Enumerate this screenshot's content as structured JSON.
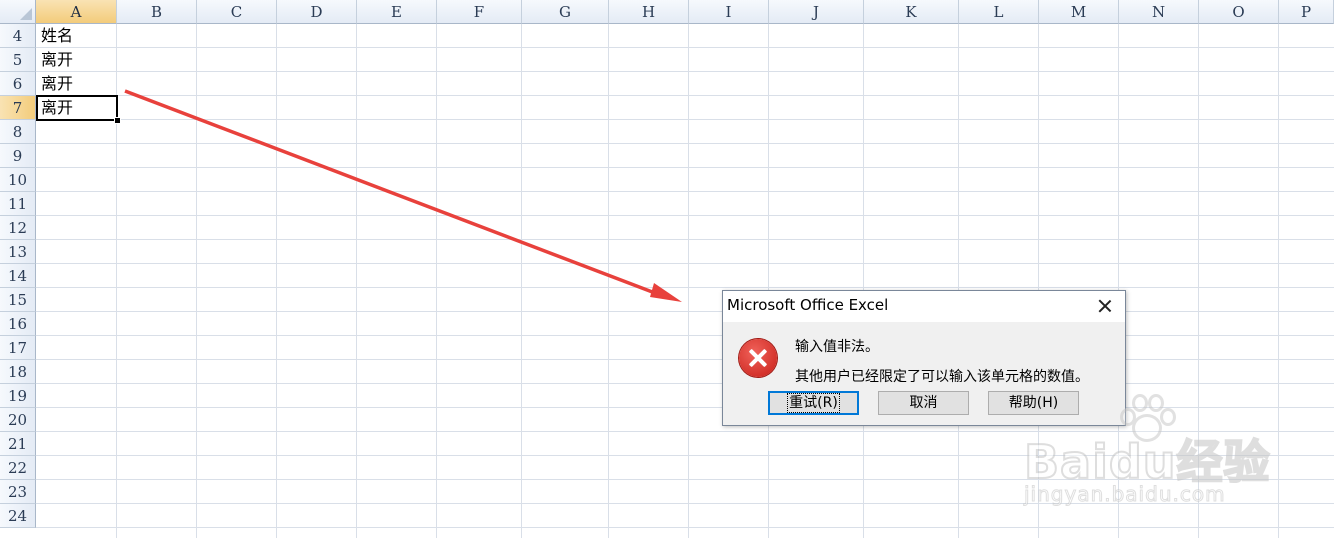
{
  "spreadsheet": {
    "columns": [
      "A",
      "B",
      "C",
      "D",
      "E",
      "F",
      "G",
      "H",
      "I",
      "J",
      "K",
      "L",
      "M",
      "N",
      "O",
      "P"
    ],
    "selected_column": "A",
    "rows": [
      "4",
      "5",
      "6",
      "7",
      "8",
      "9",
      "10",
      "11",
      "12",
      "13",
      "14",
      "15",
      "16",
      "17",
      "18",
      "19",
      "20",
      "21",
      "22",
      "23",
      "24"
    ],
    "selected_row": "7",
    "cells": [
      {
        "ref": "A4",
        "value": "姓名"
      },
      {
        "ref": "A5",
        "value": "离开"
      },
      {
        "ref": "A6",
        "value": "离开"
      },
      {
        "ref": "A7",
        "value": "离开"
      }
    ],
    "active_cell": "A7"
  },
  "annotation": {
    "arrow_color": "#e8413c"
  },
  "dialog": {
    "title": "Microsoft Office Excel",
    "icon": "error-icon",
    "message_line1": "输入值非法。",
    "message_line2": "其他用户已经限定了可以输入该单元格的数值。",
    "buttons": {
      "retry": "重试(R)",
      "cancel": "取消",
      "help": "帮助(H)"
    }
  },
  "watermark": {
    "main": "Baidu经验",
    "sub": "jingyan.baidu.com"
  },
  "colors": {
    "grid_line": "#d9dfe8",
    "header_bg": "#e4ebf5",
    "header_selected_bg": "#f3cc7b",
    "error_red": "#c81e17"
  }
}
